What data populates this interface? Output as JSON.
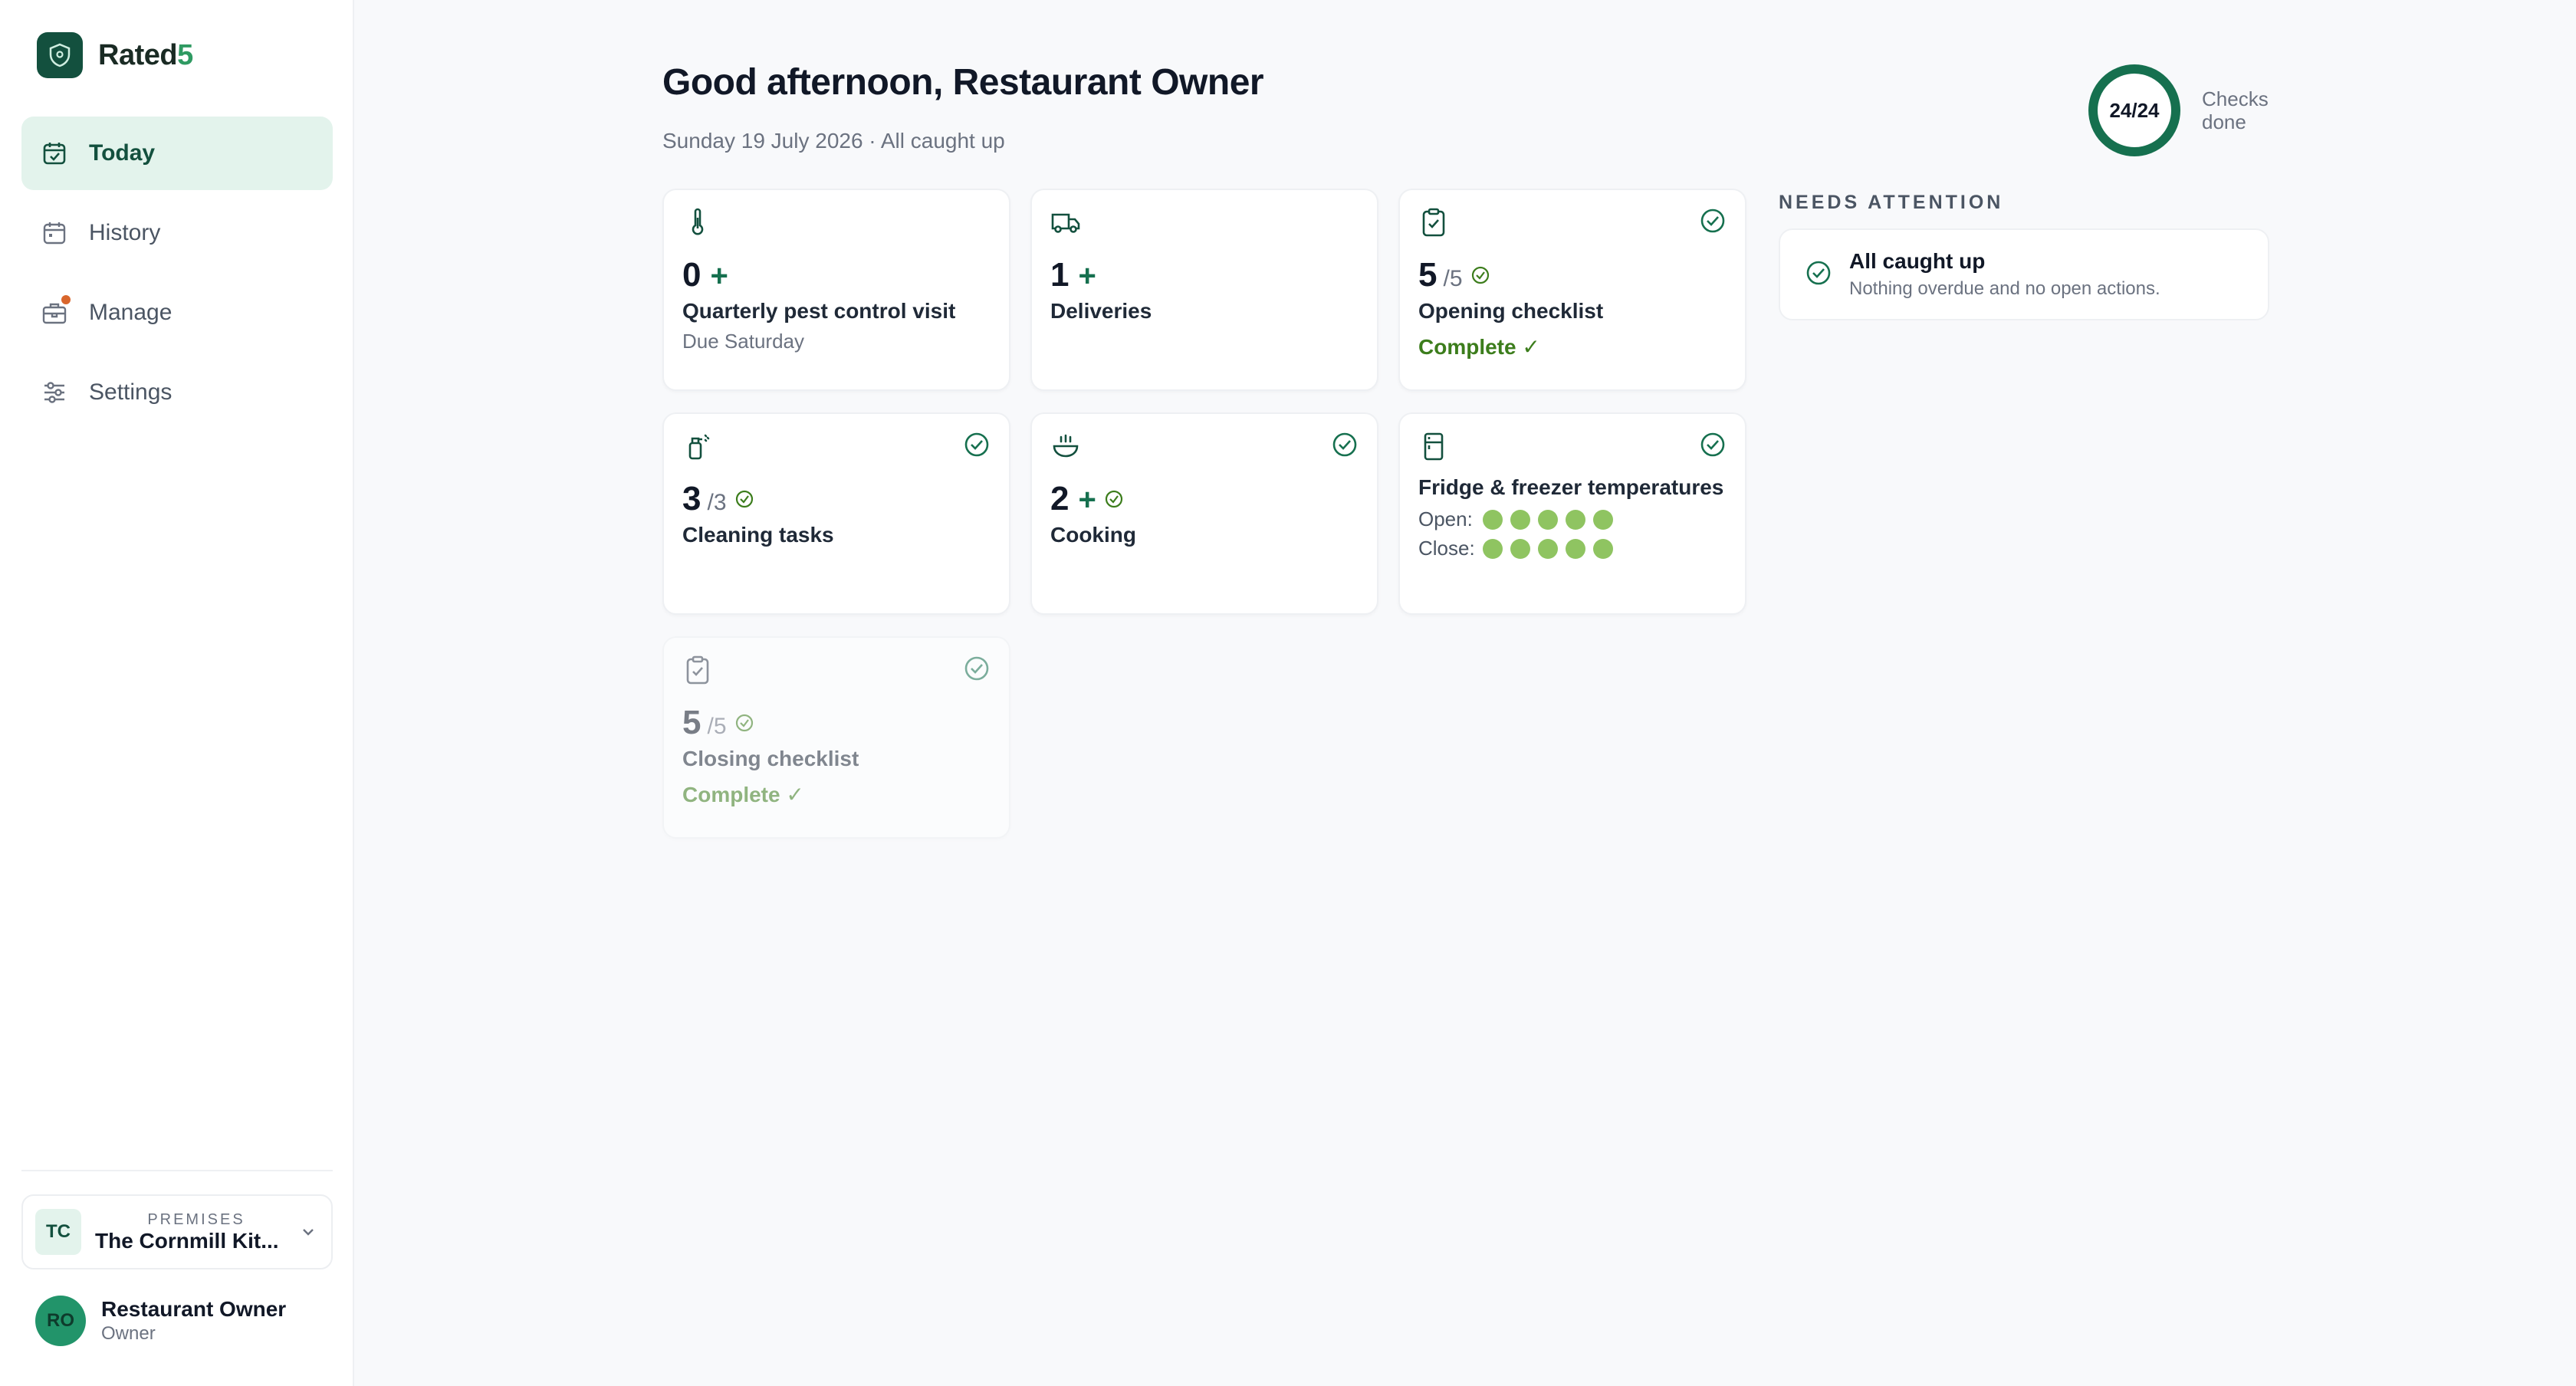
{
  "app": {
    "name_main": "Rated",
    "name_accent": "5"
  },
  "nav": {
    "items": [
      {
        "label": "Today"
      },
      {
        "label": "History"
      },
      {
        "label": "Manage"
      },
      {
        "label": "Settings"
      }
    ]
  },
  "premises": {
    "badge": "TC",
    "eyebrow": "PREMISES",
    "name": "The Cornmill Kit..."
  },
  "user": {
    "initials": "RO",
    "name": "Restaurant Owner",
    "role": "Owner"
  },
  "header": {
    "greeting": "Good afternoon, Restaurant Owner",
    "subline": "Sunday 19 July 2026 · All caught up",
    "progress": "24/24",
    "progress_label": "Checks done"
  },
  "cards": [
    {
      "value": "0",
      "plus": "+",
      "title": "Quarterly pest control visit",
      "sub": "Due Saturday"
    },
    {
      "value": "1",
      "plus": "+",
      "title": "Deliveries"
    },
    {
      "value": "5",
      "of": "/5",
      "title": "Opening checklist",
      "status": "Complete ✓"
    },
    {
      "value": "3",
      "of": "/3",
      "title": "Cleaning tasks"
    },
    {
      "value": "2",
      "plus": "+",
      "title": "Cooking"
    },
    {
      "title": "Fridge & freezer temperatures",
      "open_label": "Open:",
      "close_label": "Close:",
      "open_ok": 5,
      "close_ok": 5
    },
    {
      "value": "5",
      "of": "/5",
      "title": "Closing checklist",
      "status": "Complete ✓"
    }
  ],
  "attention": {
    "heading": "NEEDS ATTENTION",
    "title": "All caught up",
    "sub": "Nothing overdue and no open actions."
  },
  "colors": {
    "brand": "#13503e",
    "accent": "#2f9a62",
    "complete": "#3c7d1c",
    "dot": "#8fc461"
  }
}
